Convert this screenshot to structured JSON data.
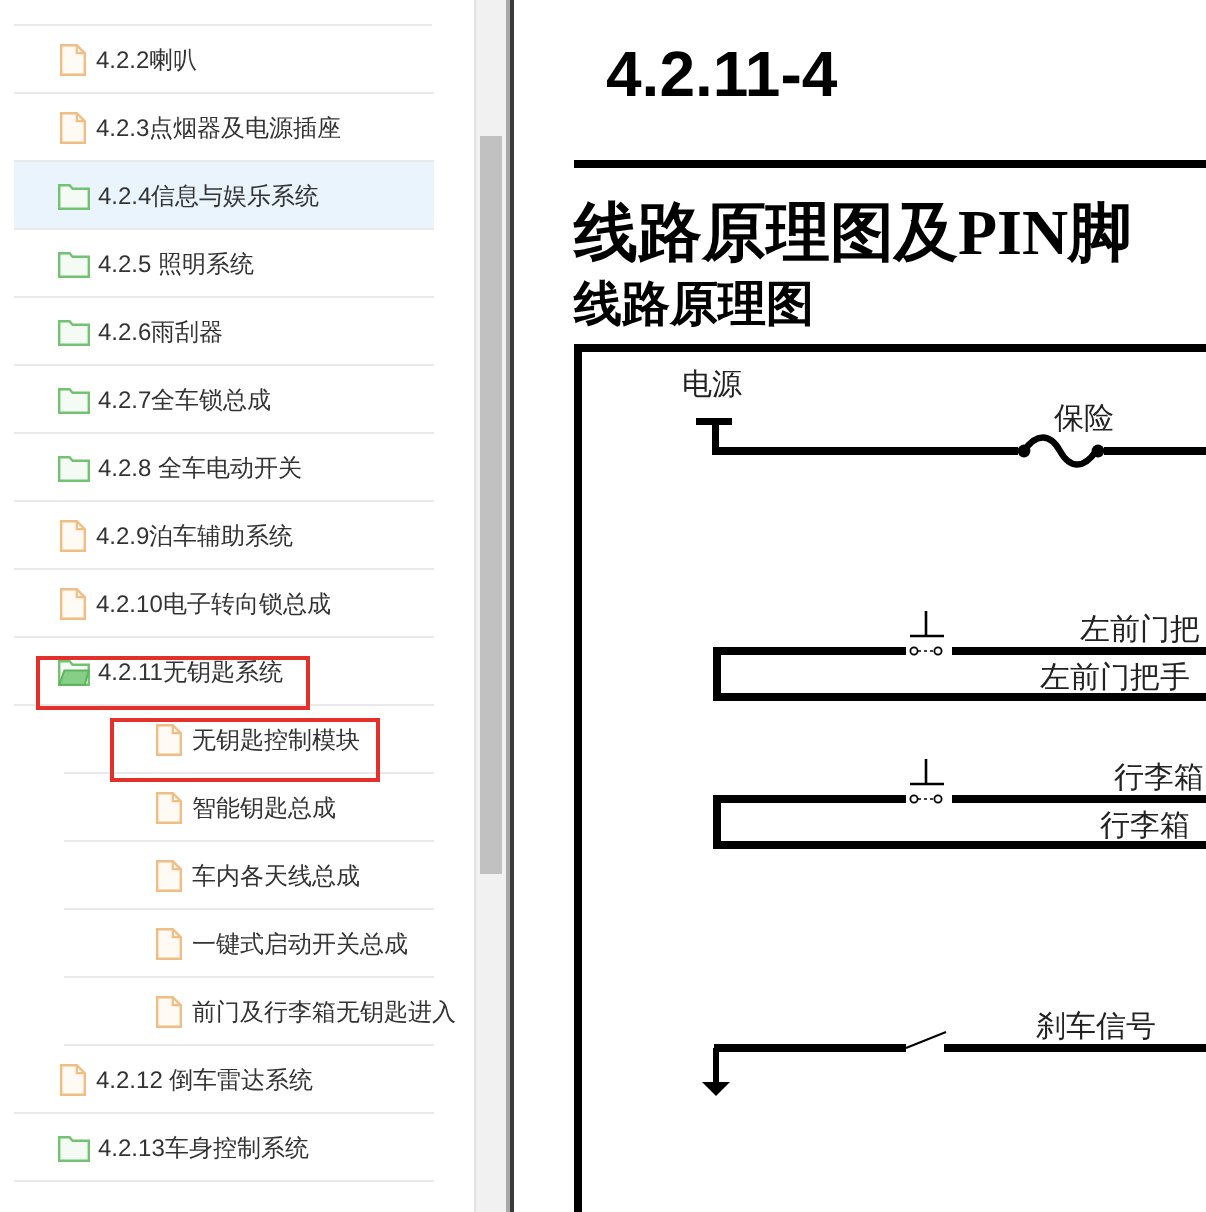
{
  "tree": {
    "items": [
      {
        "kind": "document",
        "label": "4.2.2喇叭",
        "selected": false,
        "annotated": false
      },
      {
        "kind": "document",
        "label": "4.2.3点烟器及电源插座",
        "selected": false,
        "annotated": false
      },
      {
        "kind": "folder",
        "label": "4.2.4信息与娱乐系统",
        "selected": true,
        "expanded": false,
        "annotated": false
      },
      {
        "kind": "folder",
        "label": "4.2.5 照明系统",
        "selected": false,
        "expanded": false,
        "annotated": false
      },
      {
        "kind": "folder",
        "label": "4.2.6雨刮器",
        "selected": false,
        "expanded": false,
        "annotated": false
      },
      {
        "kind": "folder",
        "label": "4.2.7全车锁总成",
        "selected": false,
        "expanded": false,
        "annotated": false
      },
      {
        "kind": "folder",
        "label": "4.2.8 全车电动开关",
        "selected": false,
        "expanded": false,
        "annotated": false
      },
      {
        "kind": "document",
        "label": "4.2.9泊车辅助系统",
        "selected": false,
        "annotated": false
      },
      {
        "kind": "document",
        "label": "4.2.10电子转向锁总成",
        "selected": false,
        "annotated": false
      },
      {
        "kind": "folder",
        "label": "4.2.11无钥匙系统",
        "selected": false,
        "expanded": true,
        "annotated": true,
        "children": [
          {
            "kind": "document",
            "label": "无钥匙控制模块",
            "selected": false,
            "annotated": true
          },
          {
            "kind": "document",
            "label": "智能钥匙总成",
            "selected": false,
            "annotated": false
          },
          {
            "kind": "document",
            "label": "车内各天线总成",
            "selected": false,
            "annotated": false
          },
          {
            "kind": "document",
            "label": "一键式启动开关总成",
            "selected": false,
            "annotated": false
          },
          {
            "kind": "document",
            "label": "前门及行李箱无钥匙进入",
            "selected": false,
            "annotated": false
          }
        ]
      },
      {
        "kind": "document",
        "label": "4.2.12 倒车雷达系统",
        "selected": false,
        "annotated": false
      },
      {
        "kind": "folder",
        "label": "4.2.13车身控制系统",
        "selected": false,
        "expanded": false,
        "annotated": false
      }
    ]
  },
  "document": {
    "page_number": "4.2.11-4",
    "heading": "线路原理图及PIN脚",
    "subheading": "线路原理图",
    "schematic": {
      "circuits": [
        {
          "kind": "power_feed",
          "source_label": "电源",
          "fuse_label": "保险"
        },
        {
          "kind": "push_switch_loop",
          "top_label": "左前门把",
          "bottom_label": "左前门把手"
        },
        {
          "kind": "push_switch_loop",
          "top_label": "行李箱",
          "bottom_label": "行李箱"
        },
        {
          "kind": "open_switch_to_ground",
          "label": "刹车信号"
        }
      ]
    }
  }
}
